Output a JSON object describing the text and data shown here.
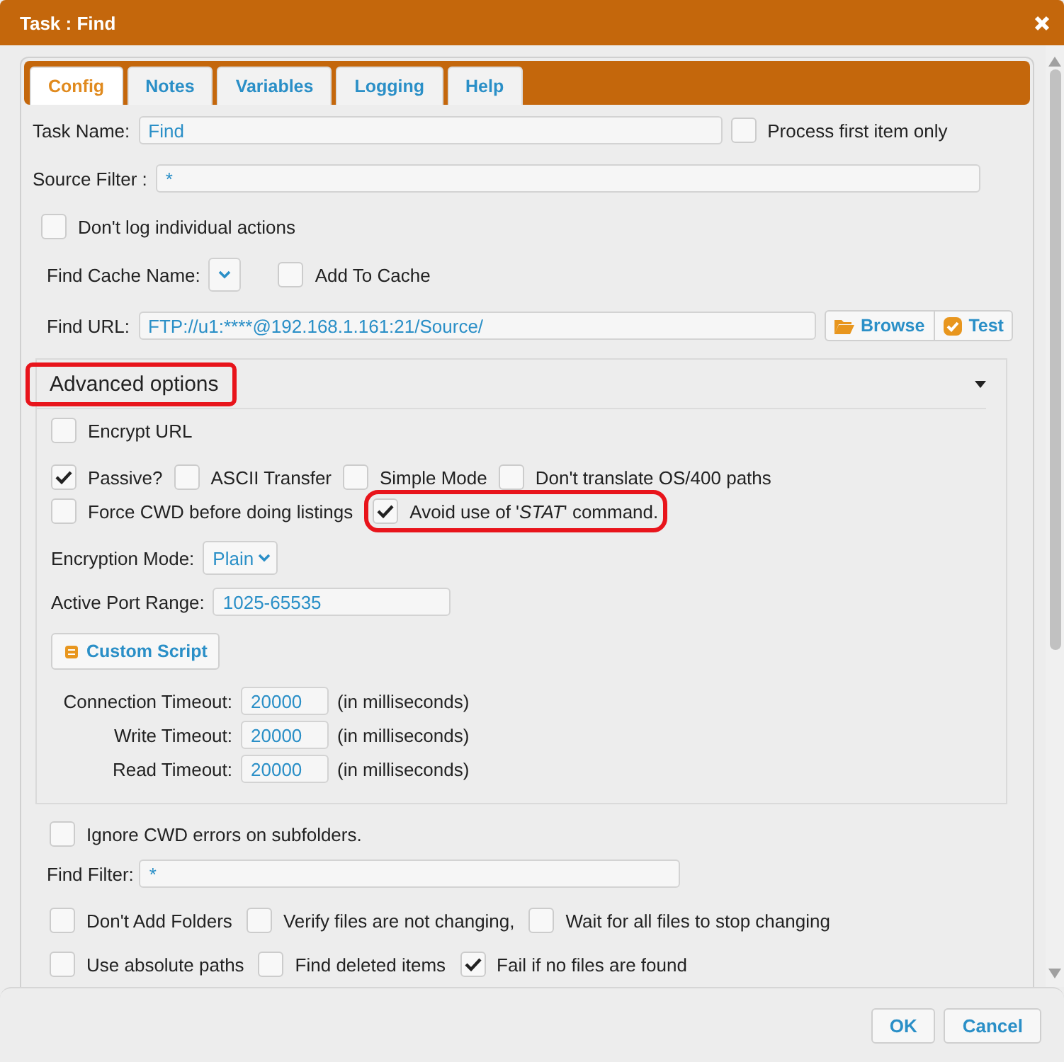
{
  "window": {
    "title": "Task : Find"
  },
  "tabs": [
    {
      "label": "Config",
      "selected": true
    },
    {
      "label": "Notes",
      "selected": false
    },
    {
      "label": "Variables",
      "selected": false
    },
    {
      "label": "Logging",
      "selected": false
    },
    {
      "label": "Help",
      "selected": false
    }
  ],
  "task_name": {
    "label": "Task Name:",
    "value": "Find"
  },
  "process_first": {
    "label": "Process first item only",
    "checked": false
  },
  "source_filter": {
    "label": "Source Filter :",
    "value": "*"
  },
  "dont_log": {
    "label": "Don't log individual actions",
    "checked": false
  },
  "find_cache": {
    "label": "Find Cache Name:"
  },
  "add_to_cache": {
    "label": "Add To Cache",
    "checked": false
  },
  "find_url": {
    "label": "Find URL:",
    "value": "FTP://u1:****@192.168.1.161:21/Source/",
    "browse": "Browse",
    "test": "Test"
  },
  "advanced": {
    "title": "Advanced options",
    "highlighted": true,
    "expanded": true,
    "encrypt_url": {
      "label": "Encrypt URL",
      "checked": false
    },
    "option_rows": [
      [
        {
          "label": "Passive?",
          "checked": true,
          "highlighted": false
        },
        {
          "label": "ASCII Transfer",
          "checked": false,
          "highlighted": false
        },
        {
          "label": "Simple Mode",
          "checked": false,
          "highlighted": false
        },
        {
          "label": "Don't translate OS/400 paths",
          "checked": false,
          "highlighted": false
        }
      ],
      [
        {
          "label": "Force CWD before doing listings",
          "checked": false,
          "highlighted": false
        },
        {
          "label": "Avoid use of '*STAT*' command.",
          "checked": true,
          "highlighted": true
        }
      ]
    ],
    "encryption_mode": {
      "label": "Encryption Mode:",
      "value": "Plain"
    },
    "active_port_range": {
      "label": "Active Port Range:",
      "value": "1025-65535"
    },
    "custom_script": "Custom Script",
    "timeouts": [
      {
        "label": "Connection Timeout:",
        "value": "20000",
        "unit": "(in milliseconds)"
      },
      {
        "label": "Write Timeout:",
        "value": "20000",
        "unit": "(in milliseconds)"
      },
      {
        "label": "Read Timeout:",
        "value": "20000",
        "unit": "(in milliseconds)"
      }
    ]
  },
  "ignore_cwd": {
    "label": "Ignore CWD errors on subfolders.",
    "checked": false
  },
  "find_filter": {
    "label": "Find Filter:",
    "value": "*"
  },
  "bottom_rows": [
    [
      {
        "label": "Don't Add Folders",
        "checked": false
      },
      {
        "label": "Verify files are not changing,",
        "checked": false
      },
      {
        "label": "Wait for all files to stop changing",
        "checked": false
      }
    ],
    [
      {
        "label": "Use absolute paths",
        "checked": false
      },
      {
        "label": "Find deleted items",
        "checked": false
      },
      {
        "label": "Fail if no files are found",
        "checked": true
      }
    ]
  ],
  "buttons": [
    "OK",
    "Cancel"
  ]
}
